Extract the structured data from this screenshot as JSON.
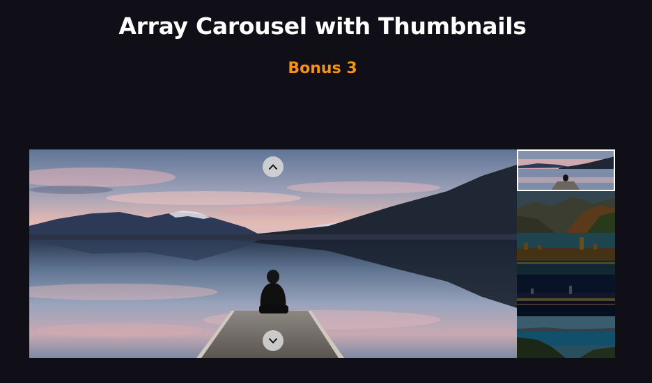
{
  "page": {
    "title": "Array Carousel with Thumbnails",
    "subtitle": "Bonus 3"
  },
  "colors": {
    "background": "#100e17",
    "title": "#ffffff",
    "subtitle": "#f39313",
    "active_thumb_border": "#ffffff"
  },
  "carousel": {
    "active_index": 0,
    "prev_icon": "chevron-up-icon",
    "next_icon": "chevron-down-icon",
    "thumbnails": [
      {
        "scene": "lake-pier-at-dusk"
      },
      {
        "scene": "mountain-valley-forest"
      },
      {
        "scene": "parliament-at-night"
      },
      {
        "scene": "city-waterfront-at-night"
      },
      {
        "scene": "coastal-bay"
      }
    ]
  }
}
